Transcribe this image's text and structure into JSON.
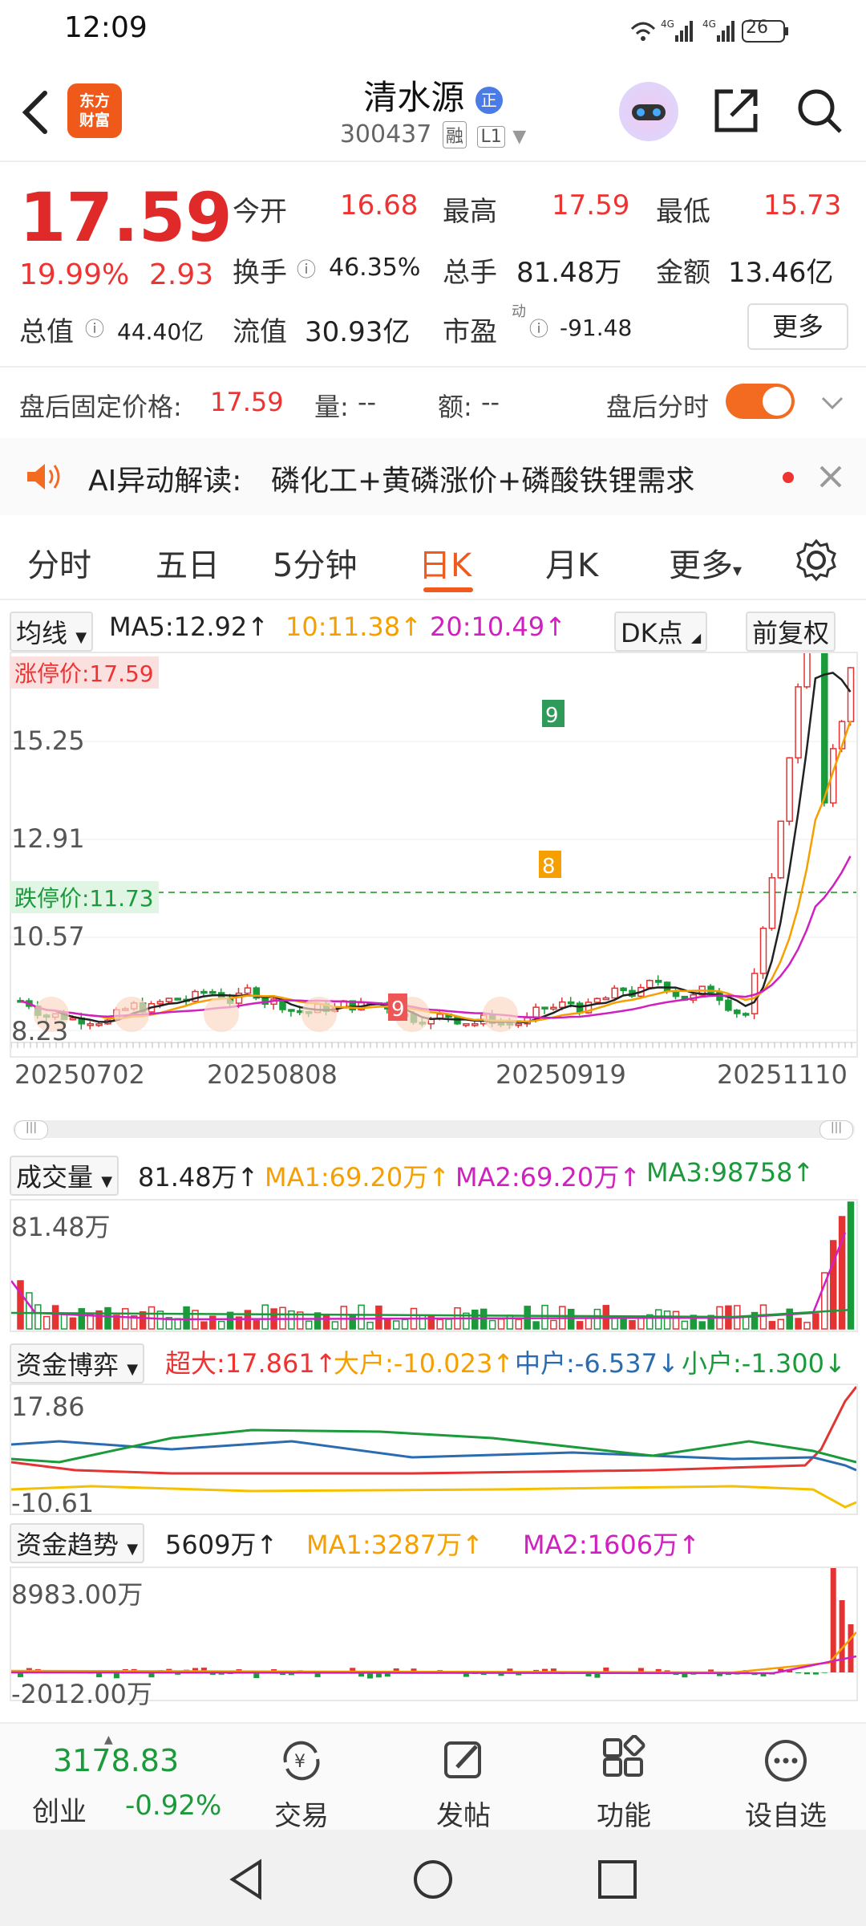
{
  "status": {
    "time": "12:09",
    "battery": "26",
    "signal1": "4G",
    "signal2": "4G"
  },
  "header": {
    "logo_line1": "东方",
    "logo_line2": "财富",
    "stock_name": "清水源",
    "name_badge": "正",
    "stock_code": "300437",
    "tag_margin": "融",
    "tag_level": "L1"
  },
  "quote": {
    "price": "17.59",
    "change_pct": "19.99%",
    "change_amt": "2.93",
    "open_label": "今开",
    "open": "16.68",
    "high_label": "最高",
    "high": "17.59",
    "low_label": "最低",
    "low": "15.73",
    "turnover_label": "换手",
    "turnover": "46.35%",
    "volume_label": "总手",
    "volume": "81.48万",
    "amount_label": "金额",
    "amount": "13.46亿",
    "mktcap_label": "总值",
    "mktcap": "44.40亿",
    "float_label": "流值",
    "float_cap": "30.93亿",
    "pe_label": "市盈",
    "pe_sup": "动",
    "pe": "-91.48",
    "more_label": "更多"
  },
  "after_hours": {
    "fixed_price_label": "盘后固定价格:",
    "fixed_price": "17.59",
    "qty_label": "量:",
    "qty": "--",
    "amt_label": "额:",
    "amt": "--",
    "toggle_label": "盘后分时",
    "toggle_on": true
  },
  "ai_banner": {
    "prefix": "AI异动解读:",
    "text": "磷化工+黄磷涨价+磷酸铁锂需求"
  },
  "tabs": [
    {
      "label": "分时",
      "active": false
    },
    {
      "label": "五日",
      "active": false
    },
    {
      "label": "5分钟",
      "active": false
    },
    {
      "label": "日K",
      "active": true
    },
    {
      "label": "月K",
      "active": false
    },
    {
      "label": "更多",
      "active": false
    }
  ],
  "kline": {
    "indicator_select": "均线",
    "ma5": "MA5:12.92↑",
    "ma10": "10:11.38↑",
    "ma20": "20:10.49↑",
    "dk_label": "DK点",
    "adjust_label": "前复权",
    "limit_up_label": "涨停价:17.59",
    "limit_down_label": "跌停价:11.73",
    "y_ticks": [
      "15.25",
      "12.91",
      "10.57",
      "8.23"
    ],
    "x_ticks": [
      "20250702",
      "20250808",
      "20250919",
      "20251110"
    ]
  },
  "volume": {
    "select": "成交量",
    "value": "81.48万↑",
    "ma1": "MA1:69.20万↑",
    "ma2": "MA2:69.20万↑",
    "ma3": "MA3:98758↑",
    "max_label": "81.48万"
  },
  "fund_game": {
    "select": "资金博弈",
    "super": "超大:17.861↑",
    "large": "大户:-10.023↑",
    "medium": "中户:-6.537↓",
    "small": "小户:-1.300↓",
    "top": "17.86",
    "bottom": "-10.61"
  },
  "fund_trend": {
    "select": "资金趋势",
    "value": "5609万↑",
    "ma1": "MA1:3287万↑",
    "ma2": "MA2:1606万↑",
    "top": "8983.00万",
    "bottom": "-2012.00万"
  },
  "bottom_nav": {
    "index_value": "3178.83",
    "index_name": "创业",
    "index_change": "-0.92%",
    "items": [
      {
        "label": "交易",
        "icon": "exchange-yen-icon"
      },
      {
        "label": "发帖",
        "icon": "edit-post-icon"
      },
      {
        "label": "功能",
        "icon": "grid-apps-icon"
      },
      {
        "label": "设自选",
        "icon": "more-dots-icon"
      }
    ]
  },
  "colors": {
    "up": "#e33333",
    "down": "#1a9a3a",
    "accent": "#f25a1b",
    "ma10": "#f5a000",
    "ma20": "#d020c0"
  }
}
